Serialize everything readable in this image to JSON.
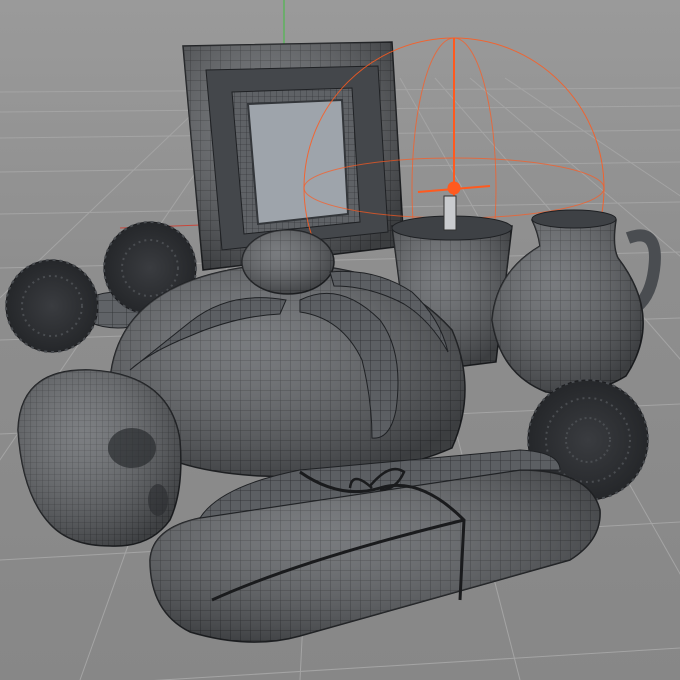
{
  "viewport": {
    "background": "#8c8c8c",
    "grid_color": "#a4a4a4",
    "axis_y_color": "#3fbf3f",
    "axis_x_color": "#c8463a",
    "selection_color": "#ff5a1f",
    "mesh_fill": "#5c5f63",
    "mesh_wire": "#2a2c2f"
  },
  "scene": {
    "objects": [
      {
        "label": "picture-frame"
      },
      {
        "label": "candle-glass"
      },
      {
        "label": "jug"
      },
      {
        "label": "pan-de-muerto"
      },
      {
        "label": "sugar-skull"
      },
      {
        "label": "wrapped-package"
      },
      {
        "label": "marigold-flowers"
      }
    ]
  }
}
